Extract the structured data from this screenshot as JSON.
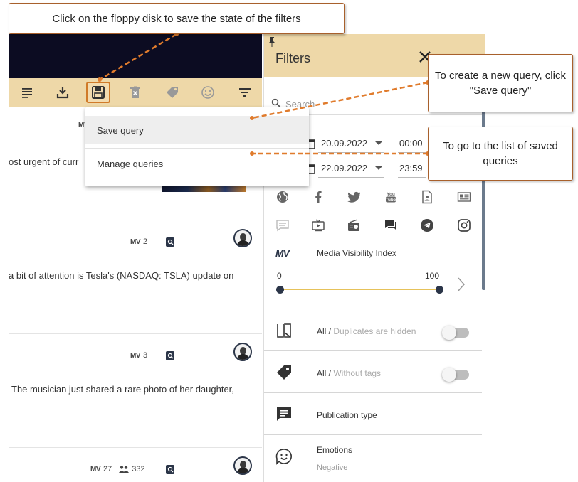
{
  "callouts": {
    "top": "Click on the floppy disk to save the state of the filters",
    "new_query": "To create a new query, click \"Save query\"",
    "list_queries": "To go to the list of saved queries"
  },
  "toolbar": {
    "icons": [
      "list-icon",
      "download-icon",
      "save-icon",
      "delete-icon",
      "tag-icon",
      "emoji-icon",
      "filter-icon"
    ]
  },
  "dropdown": {
    "save_query": "Save query",
    "manage_queries": "Manage queries"
  },
  "feed": {
    "cards": [
      {
        "meta_mv": "MV",
        "text": "ost urgent of curr"
      },
      {
        "meta_mv": "MV",
        "meta_value": "2",
        "text": "a bit of attention is Tesla's (NASDAQ: TSLA) update on"
      },
      {
        "meta_mv": "MV",
        "meta_value": "3",
        "text": "The musician just shared a rare photo of her daughter,"
      },
      {
        "meta_mv": "MV",
        "meta_value": "27",
        "meta_people": "332"
      }
    ]
  },
  "filters": {
    "title": "Filters",
    "search_placeholder": "Search",
    "date_from": "20.09.2022",
    "time_from": "00:00",
    "date_to": "22.09.2022",
    "time_to": "23:59",
    "sources_row1": [
      "globe-icon",
      "facebook-icon",
      "twitter-icon",
      "youtube-icon",
      "document-icon",
      "newspaper-icon"
    ],
    "sources_row2": [
      "comment-icon",
      "tv-icon",
      "radio-icon",
      "forum-icon",
      "telegram-icon",
      "instagram-icon"
    ],
    "mv_logo": "MV",
    "mv_label": "Media Visibility Index",
    "mv_min": "0",
    "mv_max": "100",
    "mv_range_fraction": [
      0,
      1
    ],
    "duplicates_prefix": "All /",
    "duplicates_state": "Duplicates are hidden",
    "tags_prefix": "All /",
    "tags_state": "Without tags",
    "publication_type": "Publication type",
    "emotions": "Emotions",
    "emotions_value": "Negative"
  },
  "colors": {
    "accent": "#eed8a8",
    "header_dark": "#0c0c22",
    "annotation": "#e07b2c",
    "knob": "#2b3548"
  }
}
